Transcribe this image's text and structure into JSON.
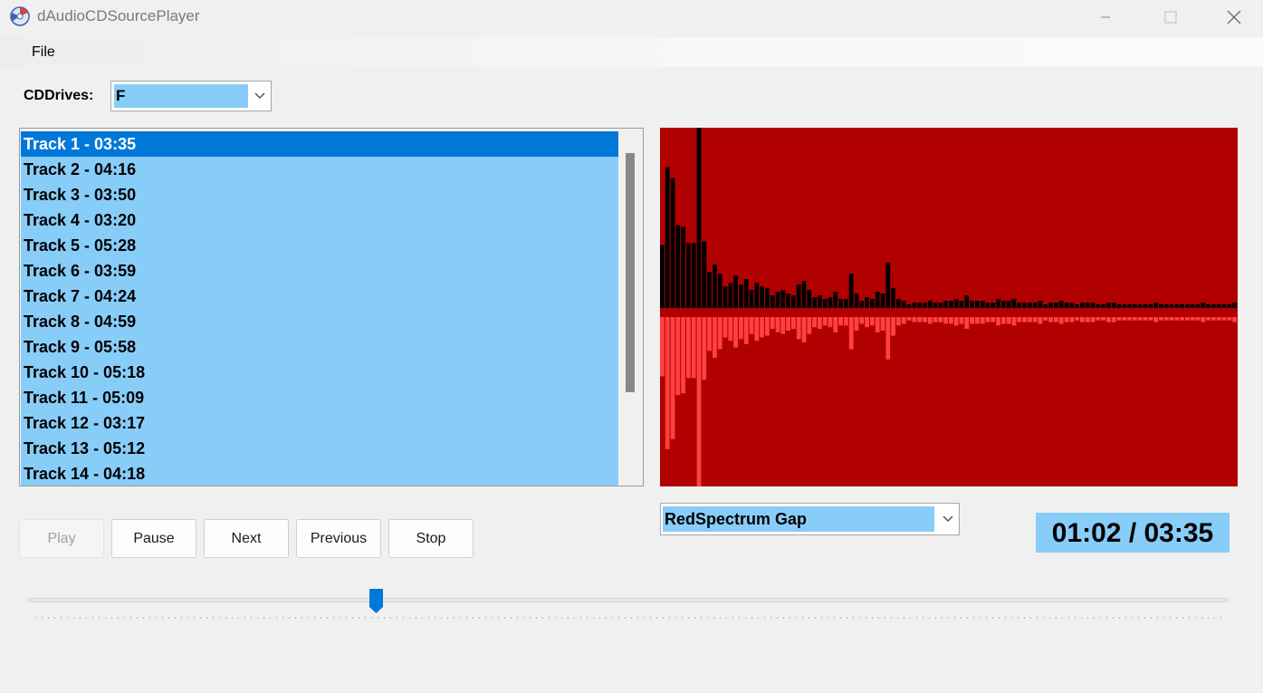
{
  "window": {
    "title": "dAudioCDSourcePlayer"
  },
  "menu": {
    "file": "File"
  },
  "cd_drives": {
    "label": "CDDrives:",
    "selected": "F"
  },
  "tracks": [
    "Track 1 - 03:35",
    "Track 2 - 04:16",
    "Track 3 - 03:50",
    "Track 4 - 03:20",
    "Track 5 - 05:28",
    "Track 6 - 03:59",
    "Track 7 - 04:24",
    "Track 8 - 04:59",
    "Track 9 - 05:58",
    "Track 10 - 05:18",
    "Track 11 - 05:09",
    "Track 12 - 03:17",
    "Track 13 - 05:12",
    "Track 14 - 04:18"
  ],
  "selected_track_index": 0,
  "visualizer": {
    "selected": "RedSpectrum Gap"
  },
  "time_display": "01:02 / 03:35",
  "buttons": {
    "play": "Play",
    "pause": "Pause",
    "next": "Next",
    "previous": "Previous",
    "stop": "Stop"
  },
  "seek_position_fraction": 0.29,
  "colors": {
    "spectrum_background": "#b00000",
    "spectrum_upper": "#000000",
    "spectrum_lower": "#ff4040",
    "highlight": "#88cdf8",
    "selection": "#0078d7"
  },
  "spectrum_levels": [
    0.35,
    0.78,
    0.72,
    0.46,
    0.45,
    0.36,
    0.36,
    1.0,
    0.37,
    0.2,
    0.24,
    0.19,
    0.12,
    0.14,
    0.18,
    0.13,
    0.16,
    0.1,
    0.14,
    0.12,
    0.11,
    0.07,
    0.09,
    0.1,
    0.08,
    0.07,
    0.13,
    0.15,
    0.1,
    0.06,
    0.07,
    0.05,
    0.06,
    0.09,
    0.05,
    0.05,
    0.19,
    0.08,
    0.04,
    0.06,
    0.05,
    0.09,
    0.08,
    0.25,
    0.11,
    0.05,
    0.04,
    0.02,
    0.03,
    0.03,
    0.03,
    0.04,
    0.03,
    0.03,
    0.04,
    0.04,
    0.05,
    0.04,
    0.07,
    0.04,
    0.04,
    0.04,
    0.03,
    0.03,
    0.05,
    0.04,
    0.04,
    0.05,
    0.03,
    0.03,
    0.03,
    0.03,
    0.04,
    0.02,
    0.03,
    0.03,
    0.04,
    0.03,
    0.03,
    0.02,
    0.03,
    0.03,
    0.03,
    0.02,
    0.02,
    0.03,
    0.03,
    0.02,
    0.02,
    0.02,
    0.02,
    0.02,
    0.02,
    0.02,
    0.03,
    0.02,
    0.02,
    0.02,
    0.02,
    0.02,
    0.02,
    0.02,
    0.02,
    0.03,
    0.02,
    0.02,
    0.02,
    0.02,
    0.02,
    0.03
  ]
}
